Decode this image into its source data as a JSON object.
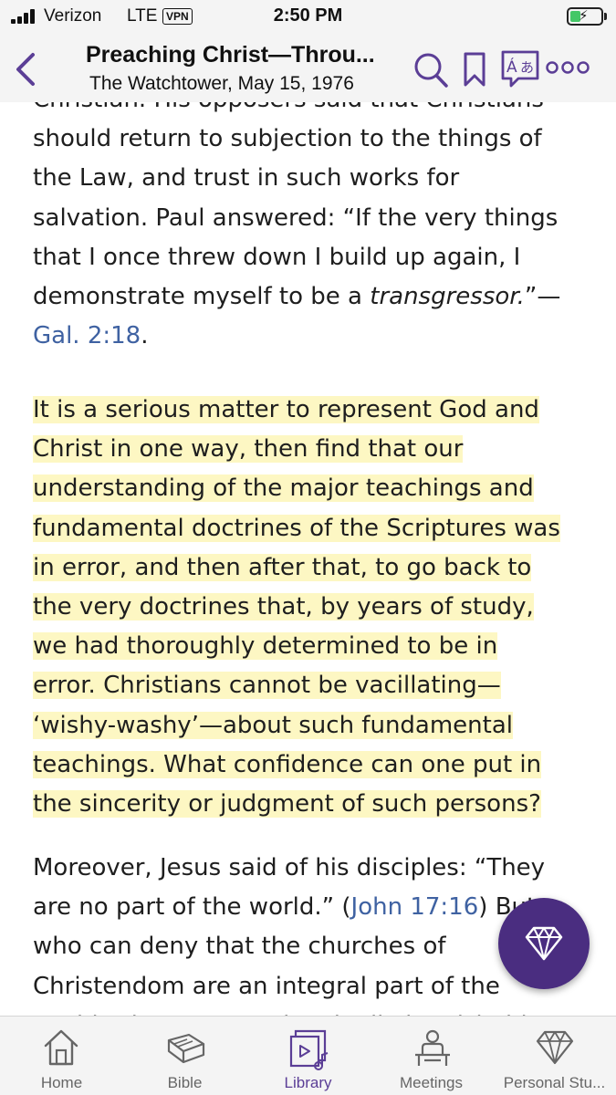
{
  "status_bar": {
    "carrier": "Verizon",
    "network": "LTE",
    "vpn": "VPN",
    "time": "2:50 PM"
  },
  "header": {
    "title": "Preaching Christ—Throu...",
    "subtitle": "The Watchtower, May 15, 1976",
    "icons": [
      "back-chevron-icon",
      "search-icon",
      "bookmark-icon",
      "language-icon",
      "more-icon"
    ]
  },
  "article": {
    "p1": {
      "lines": [
        "Christian. His opposers said that Christians",
        "should return to subjection to the things of",
        "the Law, and trust in such works for",
        "salvation. Paul answered: “If the very things",
        "that I once threw down I build up again, I"
      ],
      "line6_text": "demonstrate myself to be a ",
      "line6_italic": "transgressor.",
      "line6_end": "”—",
      "ref": "Gal. 2:18",
      "ref_end": "."
    },
    "p2": {
      "highlighted": true,
      "lines": [
        "It is a serious matter to represent God and",
        "Christ in one way, then find that our",
        "understanding of the major teachings and",
        "fundamental doctrines of the Scriptures was",
        "in error, and then after that, to go back to",
        "the very doctrines that, by years of study,",
        "we had thoroughly determined to be in",
        "error. Christians cannot be vacillating—",
        "‘wishy-washy’—about such fundamental",
        "teachings. What confidence can one put in",
        "the sincerity or judgment of such persons?"
      ]
    },
    "p3": {
      "line1": "Moreover, Jesus said of his disciples: “They",
      "line2_text": "are no part of the world.” (",
      "ref": "John 17:16",
      "line2_end": ") But",
      "line3": "who can deny that the churches of",
      "line4": "Christendom are an integral part of the",
      "line5": "world—that are not cleanly distinguishable from it"
    }
  },
  "fab": {
    "icon": "diamond-icon"
  },
  "tabs": [
    {
      "label": "Home",
      "icon": "home-icon",
      "active": false
    },
    {
      "label": "Bible",
      "icon": "bible-icon",
      "active": false
    },
    {
      "label": "Library",
      "icon": "library-icon",
      "active": true
    },
    {
      "label": "Meetings",
      "icon": "meetings-icon",
      "active": false
    },
    {
      "label": "Personal Stu...",
      "icon": "diamond-icon",
      "active": false
    }
  ],
  "colors": {
    "accent": "#5b3e96",
    "fab": "#4a2d80",
    "highlight": "#fdf7c3",
    "link": "#3f62a2",
    "bar_bg": "#f4f4f4",
    "battery": "#44c767"
  }
}
